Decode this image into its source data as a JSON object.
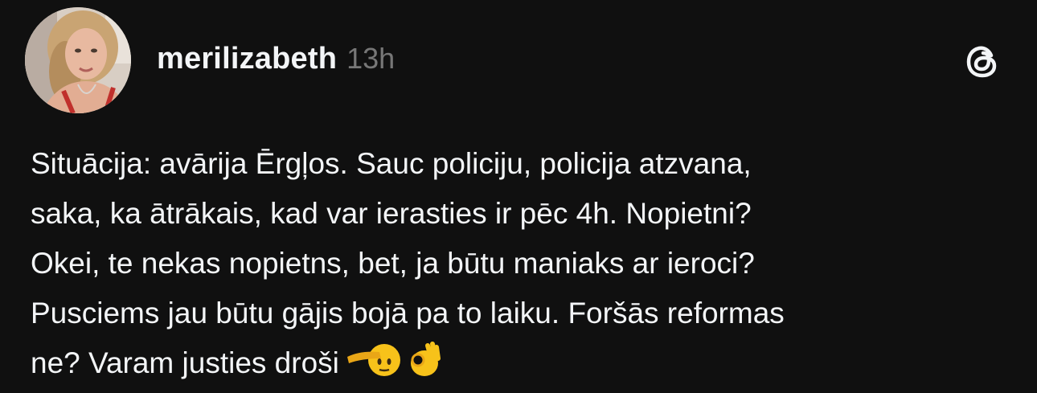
{
  "post": {
    "username": "merilizabeth",
    "time_ago": "13h",
    "avatar_icon": "profile-photo",
    "app_icon": "threads-logo-icon",
    "text_lines": [
      "Situācija: avārija Ērgļos. Sauc policiju, policija atzvana,",
      "saka, ka ātrākais, kad var ierasties ir pēc 4h. Nopietni?",
      "Okei, te nekas nopietns, bet, ja būtu maniaks ar ieroci?",
      "Pusciems jau būtu gājis bojā pa to laiku. Foršās reformas",
      "ne? Varam justies droši"
    ],
    "emojis": [
      "saluting-face-emoji",
      "ok-hand-emoji"
    ]
  },
  "colors": {
    "background": "#101010",
    "text": "#f3f5f7",
    "secondary": "#777777"
  }
}
